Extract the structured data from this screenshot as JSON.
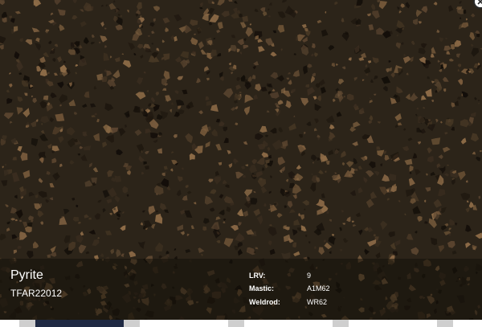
{
  "product": {
    "name": "Pyrite",
    "code": "TFAR22012"
  },
  "specs": [
    {
      "label": "LRV:",
      "value": "9"
    },
    {
      "label": "Mastic:",
      "value": "A1M62"
    },
    {
      "label": "Weldrod:",
      "value": "WR62"
    }
  ],
  "icons": {
    "close": "close-icon"
  },
  "colors": {
    "swatch_base": "#2c2419",
    "chip_light": "#7a5c3c",
    "chip_dark": "#130e09",
    "info_bar": "#14100a",
    "thumb_fill": "#cfcfcf",
    "thumb_active": "#1f2a44"
  }
}
